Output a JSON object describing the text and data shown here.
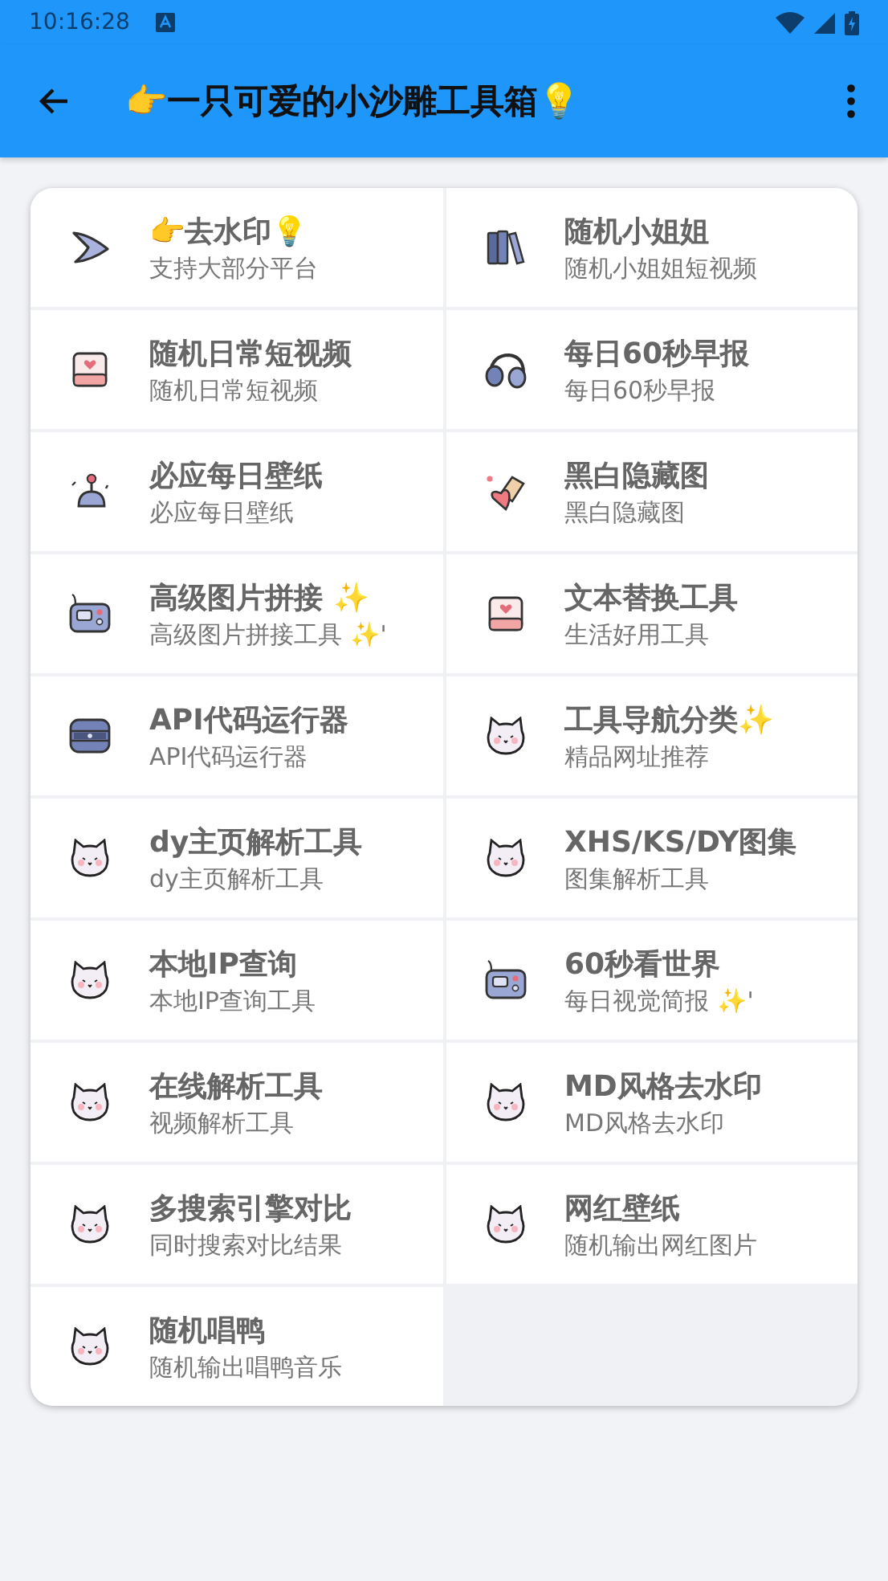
{
  "status_bar": {
    "time": "10:16:28"
  },
  "app_bar": {
    "title": "👉一只可爱的小沙雕工具箱💡"
  },
  "tools": [
    {
      "kind": "arrow",
      "title": "👉去水印💡",
      "subtitle": "支持大部分平台"
    },
    {
      "kind": "books",
      "title": "随机小姐姐",
      "subtitle": "随机小姐姐短视频"
    },
    {
      "kind": "notebook",
      "title": "随机日常短视频",
      "subtitle": "随机日常短视频"
    },
    {
      "kind": "headphones",
      "title": "每日60秒早报",
      "subtitle": "每日60秒早报"
    },
    {
      "kind": "joystick",
      "title": "必应每日壁纸",
      "subtitle": "必应每日壁纸"
    },
    {
      "kind": "eraser",
      "title": "黑白隐藏图",
      "subtitle": "黑白隐藏图"
    },
    {
      "kind": "radio",
      "title": "高级图片拼接 ✨",
      "subtitle": "高级图片拼接工具 ✨'"
    },
    {
      "kind": "notebook",
      "title": "文本替换工具",
      "subtitle": "生活好用工具"
    },
    {
      "kind": "server",
      "title": "API代码运行器",
      "subtitle": "API代码运行器"
    },
    {
      "kind": "cat",
      "title": "工具导航分类✨",
      "subtitle": "精品网址推荐"
    },
    {
      "kind": "cat",
      "title": "dy主页解析工具",
      "subtitle": "dy主页解析工具"
    },
    {
      "kind": "cat",
      "title": "XHS/KS/DY图集",
      "subtitle": "图集解析工具"
    },
    {
      "kind": "cat",
      "title": "本地IP查询",
      "subtitle": "本地IP查询工具"
    },
    {
      "kind": "radio",
      "title": "60秒看世界",
      "subtitle": "每日视觉简报 ✨'"
    },
    {
      "kind": "cat",
      "title": "在线解析工具",
      "subtitle": "视频解析工具"
    },
    {
      "kind": "cat",
      "title": "MD风格去水印",
      "subtitle": "MD风格去水印"
    },
    {
      "kind": "cat",
      "title": "多搜索引擎对比",
      "subtitle": "同时搜索对比结果"
    },
    {
      "kind": "cat",
      "title": "网红壁纸",
      "subtitle": "随机输出网红图片"
    },
    {
      "kind": "cat",
      "title": "随机唱鸭",
      "subtitle": "随机输出唱鸭音乐"
    }
  ]
}
